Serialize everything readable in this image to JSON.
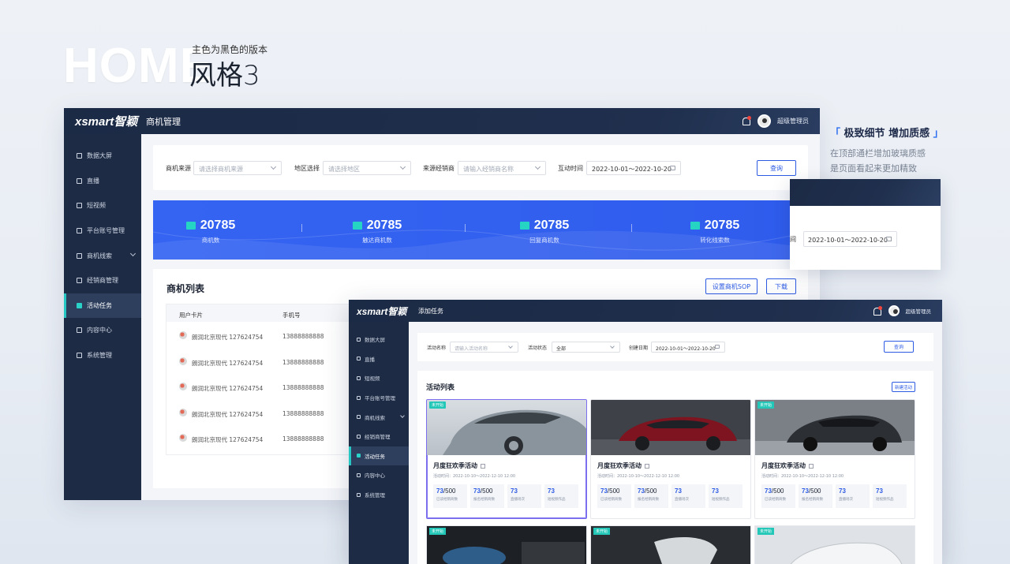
{
  "hero": {
    "home": "HOME",
    "subtitle": "主色为黑色的版本",
    "style": "风格3"
  },
  "side_note": {
    "title_bracket_l": "「",
    "title": "极致细节 增加质感",
    "title_bracket_r": "」",
    "line1": "在顶部通栏增加玻璃质感",
    "line2": "是页面看起来更加精致"
  },
  "window1": {
    "logo": "xsmart智颖",
    "page_title": "商机管理",
    "user": "超级管理员",
    "nav": [
      "数据大屏",
      "直播",
      "短视频",
      "平台账号管理",
      "商机线索",
      "经销商管理",
      "活动任务",
      "内容中心",
      "系统管理"
    ],
    "filters": {
      "source_label": "商机来源",
      "source_placeholder": "请选择商机来源",
      "region_label": "地区选择",
      "region_placeholder": "请选择地区",
      "dealer_label": "来源经销商",
      "dealer_placeholder": "请输入经销商名称",
      "time_label": "互动时间",
      "time_value": "2022-10-01～2022-10-20",
      "query": "查询"
    },
    "stats": [
      {
        "value": "20785",
        "label": "商机数"
      },
      {
        "value": "20785",
        "label": "触达商机数"
      },
      {
        "value": "20785",
        "label": "回复商机数"
      },
      {
        "value": "20785",
        "label": "转化线索数"
      }
    ],
    "list": {
      "title": "商机列表",
      "sop_button": "设置商机SOP",
      "download_button": "下载",
      "columns": [
        "用户卡片",
        "手机号"
      ],
      "rows": [
        {
          "name": "朗润北京现代 127624754",
          "phone": "13888888888"
        },
        {
          "name": "朗润北京现代 127624754",
          "phone": "13888888888"
        },
        {
          "name": "朗润北京现代 127624754",
          "phone": "13888888888"
        },
        {
          "name": "朗润北京现代 127624754",
          "phone": "13888888888"
        },
        {
          "name": "朗润北京现代 127624754",
          "phone": "13888888888"
        }
      ]
    }
  },
  "float_panel": {
    "label": "间",
    "date": "2022-10-01～2022-10-20"
  },
  "window2": {
    "logo": "xsmart智颖",
    "page_title": "添加任务",
    "user": "超级管理员",
    "nav": [
      "数据大屏",
      "直播",
      "短视频",
      "平台账号管理",
      "商机线索",
      "经销商管理",
      "活动任务",
      "内容中心",
      "系统管理"
    ],
    "filters": {
      "name_label": "活动名称",
      "name_placeholder": "请输入活动名称",
      "status_label": "活动状态",
      "status_value": "全部",
      "date_label": "创建日期",
      "date_value": "2022-10-01～2022-10-20",
      "query": "查询"
    },
    "activities": {
      "title": "活动列表",
      "new_button": "新建活动",
      "cards": [
        {
          "tag": "未开始",
          "title": "月度狂欢季活动",
          "date": "活动时间：2022-10-10～2022-12-10  12:00",
          "metrics": [
            {
              "v": "73",
              "t": "/500",
              "l": "已读经销商数"
            },
            {
              "v": "73",
              "t": "/500",
              "l": "报名经销商数"
            },
            {
              "v": "73",
              "t": "",
              "l": "直播场次"
            },
            {
              "v": "73",
              "t": "",
              "l": "短视频作品"
            }
          ]
        },
        {
          "tag": "",
          "title": "月度狂欢季活动",
          "date": "活动时间：2022-10-10～2022-12-10  12:00",
          "metrics": [
            {
              "v": "73",
              "t": "/500",
              "l": "已读经销商数"
            },
            {
              "v": "73",
              "t": "/500",
              "l": "报名经销商数"
            },
            {
              "v": "73",
              "t": "",
              "l": "直播场次"
            },
            {
              "v": "73",
              "t": "",
              "l": "短视频作品"
            }
          ]
        },
        {
          "tag": "未开始",
          "title": "月度狂欢季活动",
          "date": "活动时间：2022-10-10～2022-12-10  12:00",
          "metrics": [
            {
              "v": "73",
              "t": "/500",
              "l": "已读经销商数"
            },
            {
              "v": "73",
              "t": "/500",
              "l": "报名经销商数"
            },
            {
              "v": "73",
              "t": "",
              "l": "直播场次"
            },
            {
              "v": "73",
              "t": "",
              "l": "短视频作品"
            }
          ]
        }
      ],
      "second_row_tags": [
        "未开始",
        "未开始",
        "未开始"
      ]
    }
  }
}
